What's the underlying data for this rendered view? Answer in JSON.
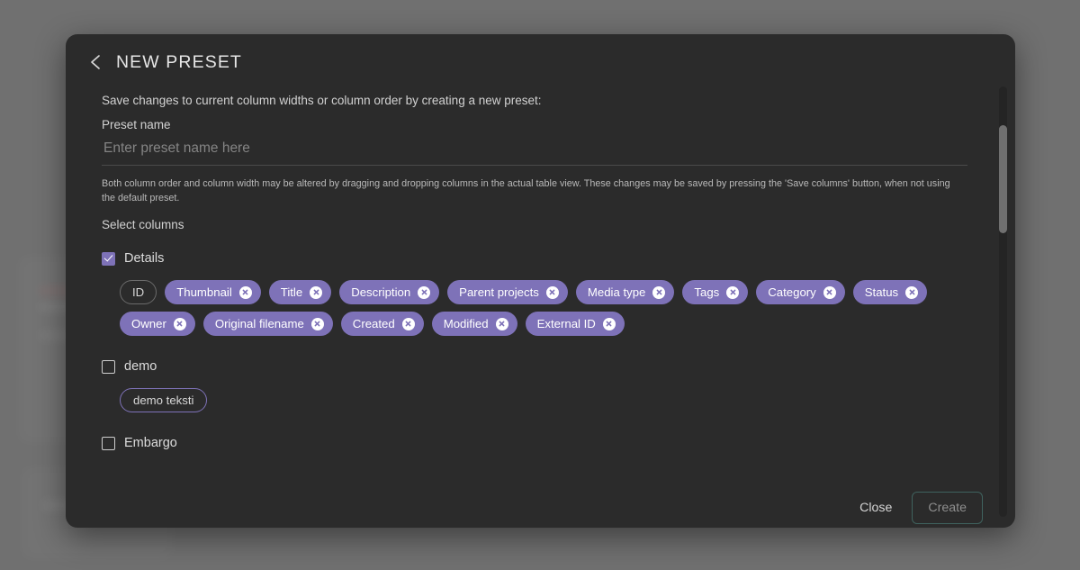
{
  "modal": {
    "title": "NEW PRESET",
    "back_icon": "chevron-left-icon",
    "intro": "Save changes to current column widths or column order by creating a new preset:",
    "preset_name_label": "Preset name",
    "preset_name_value": "",
    "preset_name_placeholder": "Enter preset name here",
    "helper_text": "Both column order and column width may be altered by dragging and dropping columns in the actual table view. These changes may be saved by pressing the 'Save columns' button, when not using the default preset.",
    "select_columns_label": "Select columns"
  },
  "groups": [
    {
      "label": "Details",
      "checked": true,
      "chips": [
        {
          "label": "ID",
          "style": "outline-gray",
          "removable": false
        },
        {
          "label": "Thumbnail",
          "style": "filled",
          "removable": true
        },
        {
          "label": "Title",
          "style": "filled",
          "removable": true
        },
        {
          "label": "Description",
          "style": "filled",
          "removable": true
        },
        {
          "label": "Parent projects",
          "style": "filled",
          "removable": true
        },
        {
          "label": "Media type",
          "style": "filled",
          "removable": true
        },
        {
          "label": "Tags",
          "style": "filled",
          "removable": true
        },
        {
          "label": "Category",
          "style": "filled",
          "removable": true
        },
        {
          "label": "Status",
          "style": "filled",
          "removable": true
        },
        {
          "label": "Owner",
          "style": "filled",
          "removable": true
        },
        {
          "label": "Original filename",
          "style": "filled",
          "removable": true
        },
        {
          "label": "Created",
          "style": "filled",
          "removable": true
        },
        {
          "label": "Modified",
          "style": "filled",
          "removable": true
        },
        {
          "label": "External ID",
          "style": "filled",
          "removable": true
        }
      ]
    },
    {
      "label": "demo",
      "checked": false,
      "chips": [
        {
          "label": "demo teksti",
          "style": "outline-purple",
          "removable": false
        }
      ]
    },
    {
      "label": "Embargo",
      "checked": false,
      "chips": []
    }
  ],
  "footer": {
    "close_label": "Close",
    "create_label": "Create"
  },
  "colors": {
    "accent_purple": "#7e72b8",
    "modal_background": "#2b2b2b",
    "backdrop": "#7f7f7f",
    "create_border": "#3f625e"
  },
  "scrollbar": {
    "thumb_top_pct": 9,
    "thumb_height_pct": 25
  }
}
